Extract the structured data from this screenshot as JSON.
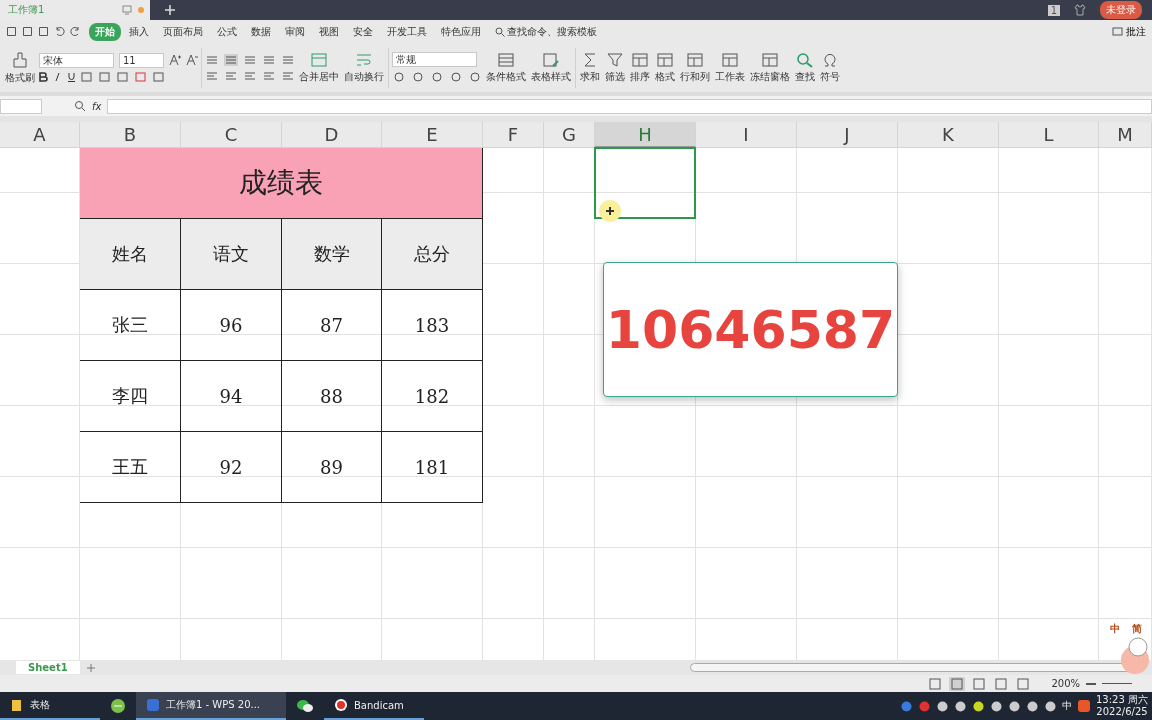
{
  "title_bar": {
    "tabs": [
      {
        "label": "工作簿1",
        "selected": true
      }
    ],
    "badge": "1",
    "login_button": "未登录"
  },
  "menu": {
    "items": [
      {
        "label": "开始",
        "selected": true
      },
      {
        "label": "插入",
        "selected": false
      },
      {
        "label": "页面布局",
        "selected": false
      },
      {
        "label": "公式",
        "selected": false
      },
      {
        "label": "数据",
        "selected": false
      },
      {
        "label": "审阅",
        "selected": false
      },
      {
        "label": "视图",
        "selected": false
      },
      {
        "label": "安全",
        "selected": false
      },
      {
        "label": "开发工具",
        "selected": false
      },
      {
        "label": "特色应用",
        "selected": false
      }
    ],
    "search": "查找命令、搜索模板",
    "comment_button": "批注"
  },
  "ribbon": {
    "format_painter": "格式刷",
    "font_name": "宋体",
    "font_size": "11",
    "merge": "合并居中",
    "wrap": "自动换行",
    "number_format": "常规",
    "conditional_format": "条件格式",
    "table_style": "表格样式",
    "tools": [
      "求和",
      "筛选",
      "排序",
      "格式",
      "行和列",
      "工作表",
      "冻结窗格",
      "查找",
      "符号"
    ]
  },
  "formula_bar": {
    "fx": "fx"
  },
  "columns": [
    {
      "label": "A",
      "selected": false
    },
    {
      "label": "B",
      "selected": false
    },
    {
      "label": "C",
      "selected": false
    },
    {
      "label": "D",
      "selected": false
    },
    {
      "label": "E",
      "selected": false
    },
    {
      "label": "F",
      "selected": false
    },
    {
      "label": "G",
      "selected": false
    },
    {
      "label": "H",
      "selected": true
    },
    {
      "label": "I",
      "selected": false
    },
    {
      "label": "J",
      "selected": false
    },
    {
      "label": "K",
      "selected": false
    },
    {
      "label": "L",
      "selected": false
    },
    {
      "label": "M",
      "selected": false
    }
  ],
  "table": {
    "title": "成绩表",
    "headers": [
      "姓名",
      "语文",
      "数学",
      "总分"
    ],
    "rows": [
      [
        "张三",
        "96",
        "87",
        "183"
      ],
      [
        "李四",
        "94",
        "88",
        "182"
      ],
      [
        "王五",
        "92",
        "89",
        "181"
      ]
    ]
  },
  "popup": {
    "value": "10646587"
  },
  "sheet_tabs": [
    {
      "label": "Sheet1",
      "selected": true
    }
  ],
  "status_bar": {
    "zoom": "200%"
  },
  "sticker": {
    "texts": [
      "中",
      "简"
    ]
  },
  "taskbar": {
    "items": [
      {
        "label": "表格",
        "active": false
      },
      {
        "label": "工作簿1 - WPS 20...",
        "active": true
      },
      {
        "label": "Bandicam",
        "active": false
      }
    ],
    "ime": "中",
    "time": "13:23 周六",
    "date": "2022/6/25"
  }
}
